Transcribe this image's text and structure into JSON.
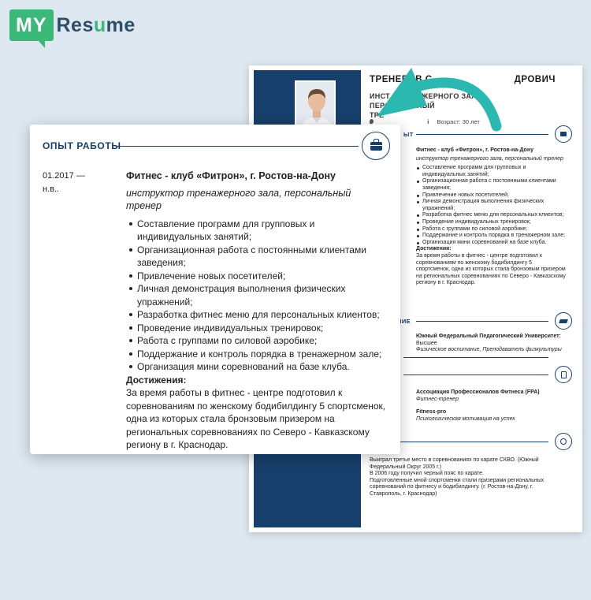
{
  "logo": {
    "my": "MY",
    "resume_a": "Res",
    "resume_u": "u",
    "resume_b": "me"
  },
  "resume": {
    "name": "ТРЕНЕРОВ С",
    "name_tail": "ДРОВИЧ",
    "title": "ИНСТ",
    "title_mid": "ЖЕРНОГО ЗАЛА, ПЕРСОНАЛЬНЫЙ",
    "title_line2": "ТРЕ",
    "age": "Возраст: 30 лет",
    "exp_label": "ЫТ",
    "exp": {
      "company": "Фитнес - клуб «Фитрон», г. Ростов-на-Дону",
      "position": "инструктор тренажерного зала, персональный тренер",
      "items": [
        "Составление программ для групповых и индивидуальных занятий;",
        "Организационная работа с постоянными клиентами заведения;",
        "Привлечение новых посетителей;",
        "Личная демонстрация выполнения физических упражнений;",
        "Разработка фитнес меню для персональных клиентов;",
        "Проведение индивидуальных тренировок;",
        "Работа с группами по силовой аэробике;",
        "Поддержание и контроль порядка в тренажерном зале;",
        "Организация мини соревнований на базе клуба."
      ],
      "ach_title": "Достижения:",
      "ach_text": "За время работы в фитнес - центре подготовил к соревнованиям по женскому бодибилдингу 5 спортсменок, одна из которых стала бронзовым призером на региональных соревнованиях по Северо - Кавказскому региону в г. Краснодар."
    },
    "edu_label": "НИЕ",
    "edu": {
      "school": "Южный Федеральный Педагогический Университет:",
      "degree": "Высшее",
      "field": "Физическое воспитание, Преподаватель физкультуры"
    },
    "courses": [
      {
        "name": "Ассоциация Профессионалов Фитнеса (FPA)",
        "desc": "Фитнес-тренер"
      },
      {
        "name": "Fitness-pro",
        "desc": "Психологическая мотивация на успех"
      }
    ],
    "extra": "Выиграл третье место в соревнованиях по карате СКВО. (Южный Федеральный Округ 2005 г.)\nВ 2006 году получил черный пояс по карате.\nПодготовленные мной спортсменки стали призерами региональных соревнований по фитнесу и бодибилдингу. (г. Ростов-на-Дону, г. Ставрополь, г. Краснодар)"
  },
  "card": {
    "section_title": "ОПЫТ РАБОТЫ",
    "date_from": "01.2017 —",
    "date_to": "н.в..",
    "company": "Фитнес - клуб «Фитрон», г. Ростов-на-Дону",
    "position": "инструктор тренажерного зала, персональный тренер",
    "items": [
      "Составление программ для групповых и индивидуальных занятий;",
      "Организационная работа с постоянными клиентами заведения;",
      "Привлечение новых посетителей;",
      "Личная демонстрация выполнения физических упражнений;",
      "Разработка фитнес меню для персональных клиентов;",
      "Проведение индивидуальных тренировок;",
      "Работа с группами по силовой аэробике;",
      "Поддержание и контроль порядка в тренажерном зале;",
      "Организация мини соревнований на базе клуба."
    ],
    "ach_title": "Достижения:",
    "ach_text": "За время работы в фитнес - центре подготовил к соревнованиям по женскому бодибилдингу 5 спортсменок, одна из которых стала бронзовым призером на региональных соревнованиях по Северо - Кавказскому региону в г. Краснодар."
  },
  "colors": {
    "brand_green": "#3cb878",
    "navy": "#173f6b",
    "teal_arrow": "#2bb8b0"
  },
  "icons": [
    "briefcase-icon",
    "graduation-cap-icon",
    "document-icon",
    "award-icon",
    "location-icon",
    "info-icon"
  ]
}
